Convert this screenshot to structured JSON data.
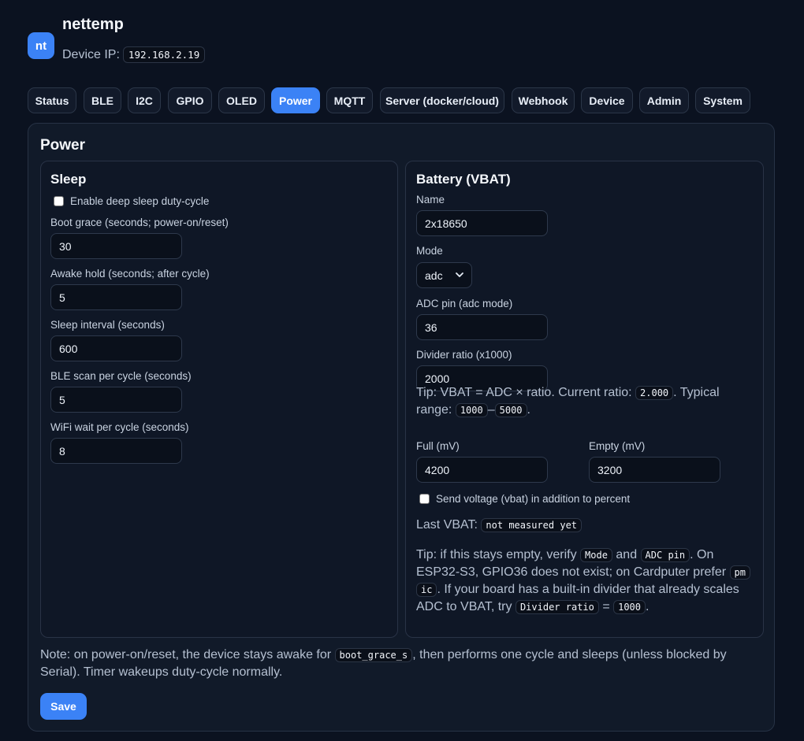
{
  "app": {
    "logo_text": "nt",
    "title": "nettemp",
    "ip_label": "Device IP:",
    "ip_value": "192.168.2.19"
  },
  "tabs": [
    {
      "label": "Status"
    },
    {
      "label": "BLE"
    },
    {
      "label": "I2C"
    },
    {
      "label": "GPIO"
    },
    {
      "label": "OLED"
    },
    {
      "label": "Power",
      "active": true
    },
    {
      "label": "MQTT"
    },
    {
      "label": "Server (docker/cloud)"
    },
    {
      "label": "Webhook"
    },
    {
      "label": "Device"
    },
    {
      "label": "Admin"
    },
    {
      "label": "System"
    }
  ],
  "panel": {
    "title": "Power"
  },
  "sleep": {
    "title": "Sleep",
    "enable_label": "Enable deep sleep duty-cycle",
    "enable_checked": false,
    "boot_grace_label": "Boot grace (seconds; power-on/reset)",
    "boot_grace_value": "30",
    "awake_hold_label": "Awake hold (seconds; after cycle)",
    "awake_hold_value": "5",
    "sleep_interval_label": "Sleep interval (seconds)",
    "sleep_interval_value": "600",
    "ble_scan_label": "BLE scan per cycle (seconds)",
    "ble_scan_value": "5",
    "wifi_wait_label": "WiFi wait per cycle (seconds)",
    "wifi_wait_value": "8"
  },
  "battery": {
    "title": "Battery (VBAT)",
    "name_label": "Name",
    "name_value": "2x18650",
    "mode_label": "Mode",
    "mode_value": "adc",
    "adc_pin_label": "ADC pin (adc mode)",
    "adc_pin_value": "36",
    "divider_label": "Divider ratio (x1000)",
    "divider_value": "2000",
    "tip1_a": "Tip: VBAT = ADC × ratio. Current ratio: ",
    "tip1_ratio": "2.000",
    "tip1_b": ". Typical",
    "tip1_c": "range: ",
    "tip1_min": "1000",
    "tip1_dash": "–",
    "tip1_max": "5000",
    "tip1_d": ".",
    "full_label": "Full (mV)",
    "full_value": "4200",
    "empty_label": "Empty (mV)",
    "empty_value": "3200",
    "send_voltage_label": "Send voltage (vbat) in addition to percent",
    "send_voltage_checked": false,
    "last_vbat_label": "Last VBAT:",
    "last_vbat_value": "not measured yet",
    "tip2_a": "Tip: if this stays empty, verify ",
    "tip2_mode": "Mode",
    "tip2_and": " and ",
    "tip2_adcpin": "ADC pin",
    "tip2_b": ". On",
    "tip2_c": "ESP32-S3, GPIO36 does not exist; on Cardputer prefer ",
    "tip2_pm": "pm",
    "tip2_ic": "ic",
    "tip2_d": ". If your board has a built-in divider that already scales",
    "tip2_e": "ADC to VBAT, try ",
    "tip2_divider": "Divider ratio",
    "tip2_eq": " = ",
    "tip2_1000": "1000",
    "tip2_f": "."
  },
  "note": {
    "a": "Note: on power-on/reset, the device stays awake for ",
    "code": "boot_grace_s",
    "b": ", then performs one cycle and sleeps (unless blocked by",
    "c": "Serial). Timer wakeups duty-cycle normally."
  },
  "save_label": "Save",
  "colors": {
    "accent": "#3b82f6",
    "background": "#0b1220",
    "panel": "#111a29"
  },
  "icons": {
    "mode_select": "chevron-down-icon"
  }
}
